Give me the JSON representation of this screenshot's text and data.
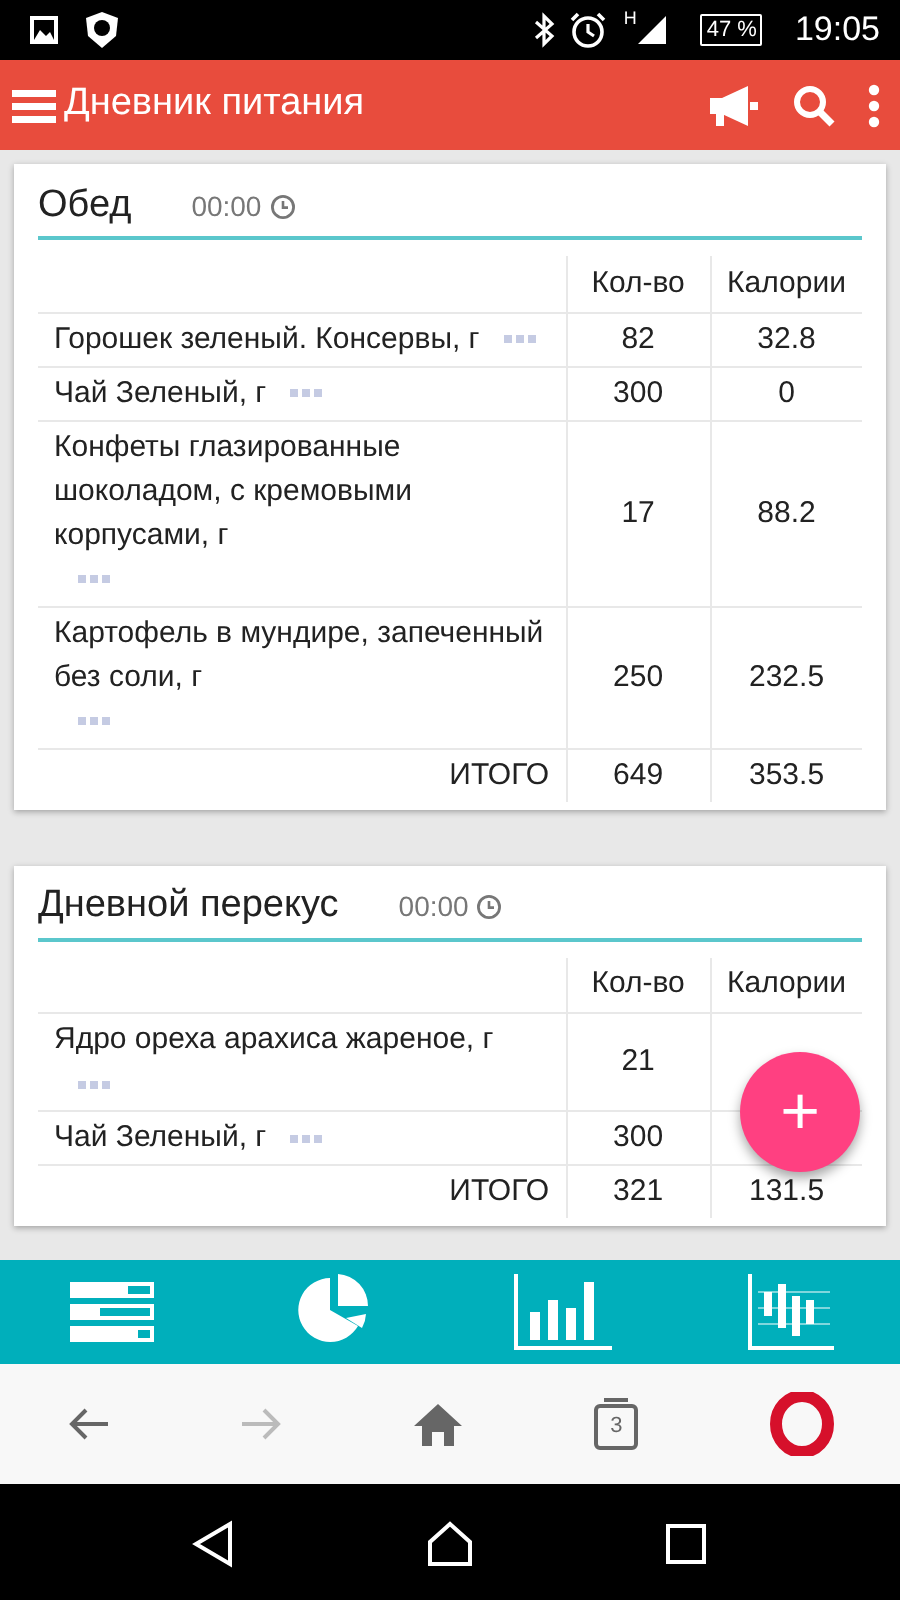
{
  "status_bar": {
    "network": "H",
    "battery": "47 %",
    "time": "19:05"
  },
  "app_bar": {
    "title": "Дневник питания"
  },
  "meals": [
    {
      "title": "Обед",
      "time": "00:00",
      "columns": [
        "Кол-во",
        "Калории"
      ],
      "items": [
        {
          "name": "Горошек зеленый. Консервы, г",
          "qty": "82",
          "calories": "32.8"
        },
        {
          "name": "Чай Зеленый, г",
          "qty": "300",
          "calories": "0"
        },
        {
          "name": "Конфеты глазированные шоколадом, с кремовыми корпусами, г",
          "qty": "17",
          "calories": "88.2"
        },
        {
          "name": "Картофель в мундире, запеченный без соли, г",
          "qty": "250",
          "calories": "232.5"
        }
      ],
      "total": {
        "label": "ИТОГО",
        "qty": "649",
        "calories": "353.5"
      }
    },
    {
      "title": "Дневной перекус",
      "time": "00:00",
      "columns": [
        "Кол-во",
        "Калории"
      ],
      "items": [
        {
          "name": "Ядро ореха арахиса жареное, г",
          "qty": "21"
        },
        {
          "name": "Чай Зеленый, г",
          "qty": "300"
        }
      ],
      "total": {
        "label": "ИТОГО",
        "qty": "321",
        "calories": "131.5"
      }
    }
  ],
  "fab": {
    "label": "+"
  },
  "browser_bar": {
    "tab_count": "3",
    "forward_disabled": true
  }
}
